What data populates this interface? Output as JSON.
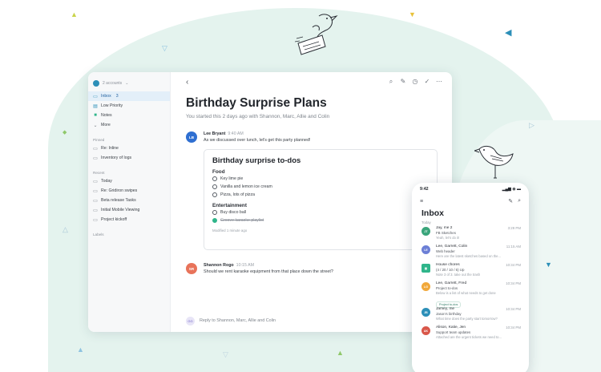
{
  "colors": {
    "accent": "#2c8fb8",
    "active_bg": "#e3eff9",
    "check_done": "#2fb58a"
  },
  "sidebar": {
    "account": "2 accounts",
    "nav": [
      {
        "label": "Inbox",
        "count": "3",
        "icon": "inbox-icon",
        "active": true
      },
      {
        "label": "Low Priority",
        "icon": "low-priority-icon"
      },
      {
        "label": "Notes",
        "icon": "notes-icon"
      },
      {
        "label": "More",
        "icon": "chevron-down-icon"
      }
    ],
    "pinned_label": "Pinned",
    "pinned": [
      "Re: Inline",
      "Inventory of logs"
    ],
    "recent_label": "Recent",
    "recent": [
      "Today",
      "Re: Gridiron swipes",
      "Beta release Tasks",
      "Initial Mobile Viewing",
      "Project kickoff"
    ],
    "labels_label": "Labels"
  },
  "thread": {
    "title": "Birthday Surprise Plans",
    "subtitle": "You started this 2 days ago with Shannon, Marc, Allie and Colin",
    "messages": [
      {
        "initials": "LB",
        "sender": "Lee Bryant",
        "time": "9:40 AM",
        "text": "As we discussed over lunch, let's get this party planned!",
        "color": "#2f6fd1"
      },
      {
        "initials": "SR",
        "sender": "Shannon Rogo",
        "time": "10:15 AM",
        "text": "Should we rent karaoke equipment from that place down the street?",
        "color": "#e8735a"
      }
    ],
    "note": {
      "title": "Birthday surprise to-dos",
      "sections": [
        {
          "heading": "Food",
          "items": [
            {
              "text": "Key lime pie",
              "done": false
            },
            {
              "text": "Vanilla and lemon ice cream",
              "done": false
            },
            {
              "text": "Pizza, lots of pizza",
              "done": false
            }
          ]
        },
        {
          "heading": "Entertainment",
          "items": [
            {
              "text": "Buy disco ball",
              "done": false
            },
            {
              "text": "Groove karaoke playlist",
              "done": true
            }
          ]
        }
      ],
      "modified": "Modified 1 minute ago"
    },
    "reply": {
      "initials": "GG",
      "placeholder": "Reply to Shannon, Marc, Allie and Colin"
    }
  },
  "phone": {
    "time": "9:42",
    "status_icons": "▂▄▆ ◉ ▬",
    "title": "Inbox",
    "section": "Today",
    "rows": [
      {
        "initials": "JT",
        "color": "#3aa57b",
        "from": "Jay, me 2",
        "time": "3:29 PM",
        "subject": "FB Sketches",
        "preview": "Yeah, let's do it!"
      },
      {
        "initials": "LE",
        "color": "#6c7fd6",
        "from": "Lee, Garrett, Colin",
        "time": "11:15 AM",
        "subject": "Web header",
        "preview": "Here are the latest sketches based on the..."
      },
      {
        "initials": "HC",
        "color": "#2fb58a",
        "square": true,
        "from": "House chores",
        "time": "10:34 PM",
        "subject": "(4 / 20 / 10 / 6) Up",
        "preview": "Note 3 of 3. take out the trash"
      },
      {
        "initials": "LG",
        "color": "#f1a83a",
        "from": "Lee, Garrett, Fred",
        "time": "10:34 PM",
        "subject": "Project to-dos",
        "preview": "Below is a list of what needs to get done",
        "chip": "Project to-dos"
      },
      {
        "initials": "JB",
        "color": "#2c8fb8",
        "from": "Jamey, me",
        "time": "10:34 PM",
        "subject": "Jason's birthday",
        "preview": "What time does the party start tomorrow?"
      },
      {
        "initials": "AK",
        "color": "#d9574a",
        "from": "Alison, Katie, Jen",
        "time": "10:34 PM",
        "subject": "Support team updates",
        "preview": "Attached are the urgent tickets we need to..."
      }
    ]
  }
}
